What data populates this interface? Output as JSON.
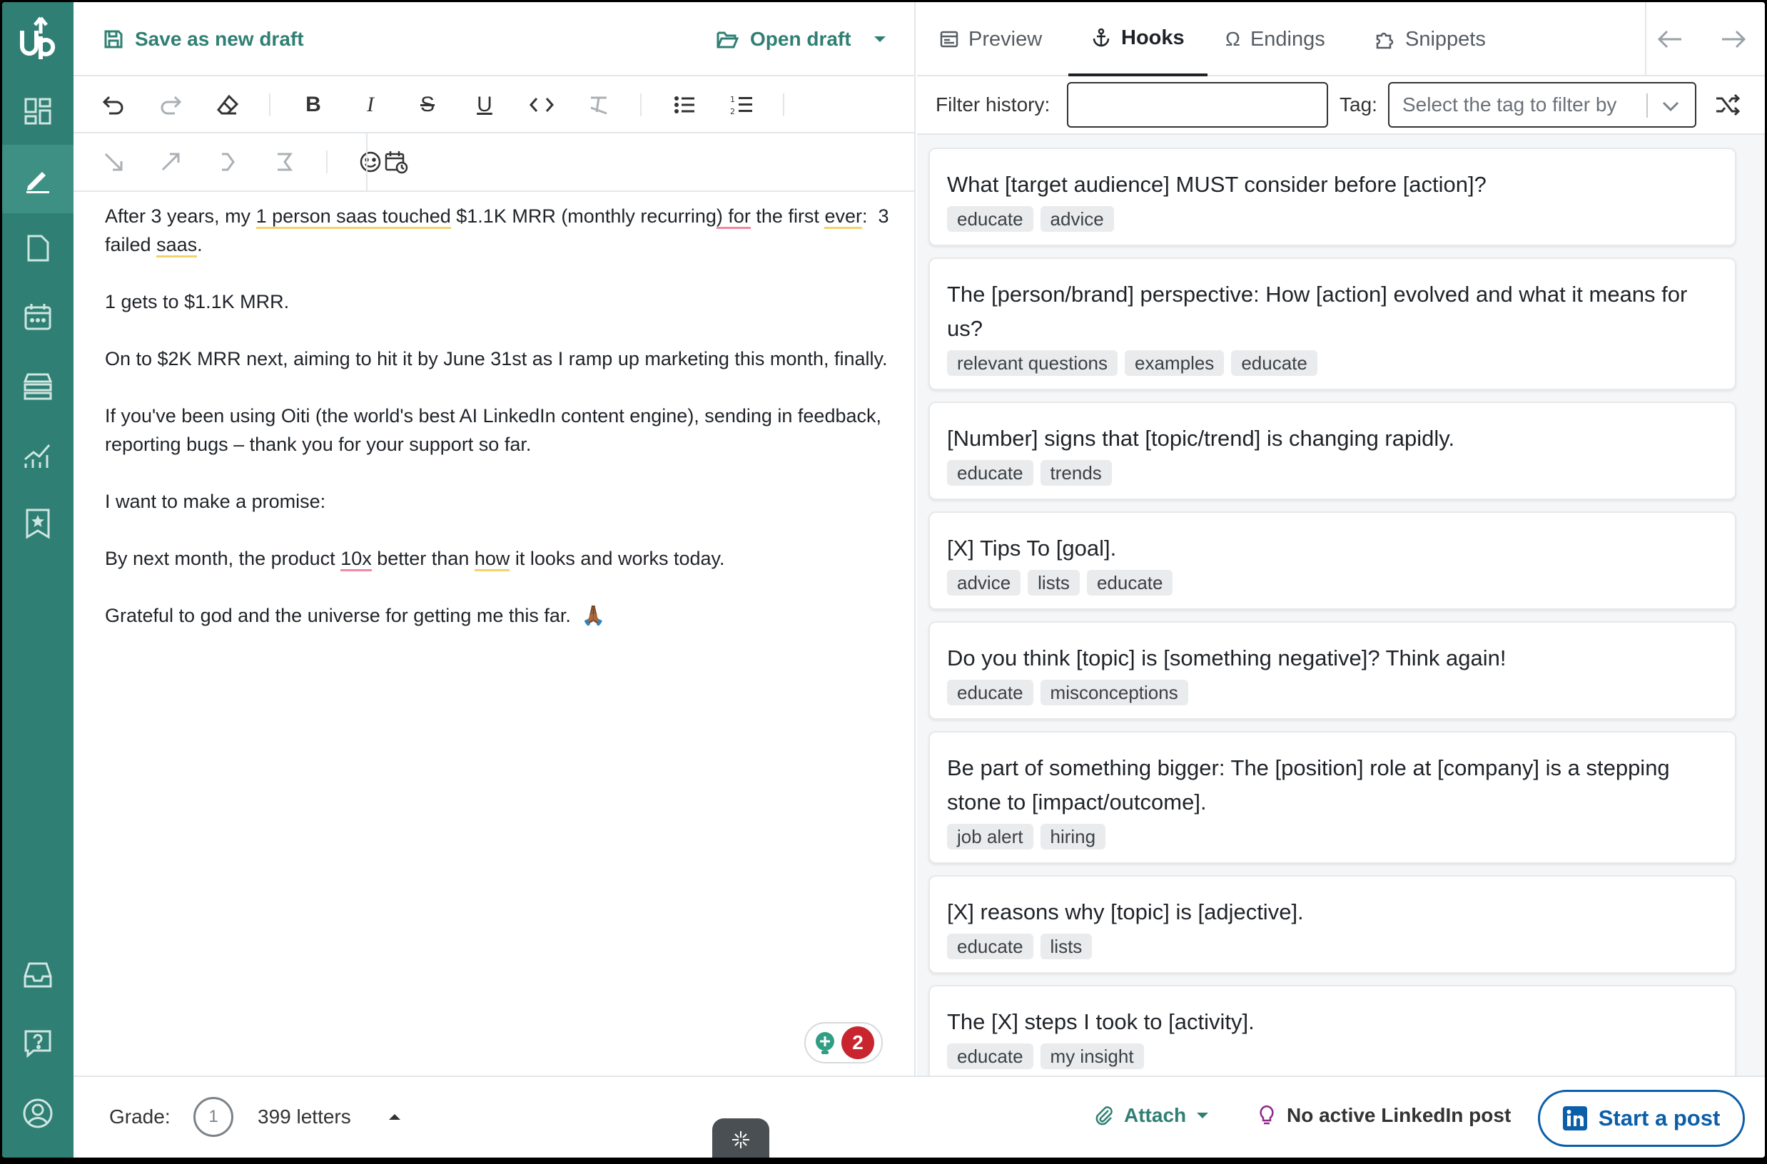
{
  "sidebar": {
    "logo_text": "up",
    "items": [
      {
        "name": "dashboard",
        "icon": "dashboard-icon"
      },
      {
        "name": "write",
        "icon": "pencil-icon",
        "active": true
      },
      {
        "name": "drafts",
        "icon": "document-icon"
      },
      {
        "name": "calendar",
        "icon": "calendar-icon"
      },
      {
        "name": "library",
        "icon": "archive-icon"
      },
      {
        "name": "analytics",
        "icon": "chart-icon"
      },
      {
        "name": "saved",
        "icon": "bookmark-star-icon"
      },
      {
        "name": "inbox",
        "icon": "inbox-icon"
      },
      {
        "name": "help",
        "icon": "help-icon"
      },
      {
        "name": "account",
        "icon": "user-icon"
      }
    ]
  },
  "editor": {
    "save_label": "Save as new draft",
    "open_label": "Open draft",
    "paragraphs": {
      "p1_a": "After 3 years, my ",
      "p1_b": "1 person saas touched",
      "p1_c": " $1.1K MRR (monthly recurring",
      "p1_d": ") for",
      "p1_e": " the first ",
      "p1_f": "ever",
      "p1_g": ":  3 failed ",
      "p1_h": "saas",
      "p1_i": ".",
      "p2": "1 gets to $1.1K MRR.",
      "p3": "On to $2K MRR next, aiming to hit it by June 31st as I ramp up marketing this month, finally.",
      "p4": "If you've been using Oiti (the world's best AI LinkedIn content engine), sending in feedback, reporting bugs – thank you for your support so far.",
      "p5": "I want to make a promise:",
      "p6_a": "By next month, the product ",
      "p6_b": "10x",
      "p6_c": " better than ",
      "p6_d": "how",
      "p6_e": " it looks and works today.",
      "p7": "Grateful to god and the universe for getting me this far.  🙏🏾"
    },
    "grammar_count": "2"
  },
  "panel": {
    "tabs": [
      {
        "label": "Preview"
      },
      {
        "label": "Hooks",
        "active": true
      },
      {
        "label": "Endings"
      },
      {
        "label": "Snippets"
      }
    ],
    "filter_label": "Filter history:",
    "filter_value": "",
    "tag_label": "Tag:",
    "tag_placeholder": "Select the tag to filter by",
    "hooks": [
      {
        "text": "What [target audience] MUST consider before [action]?",
        "tags": [
          "educate",
          "advice"
        ]
      },
      {
        "text": "The [person/brand] perspective: How [action] evolved and what it means for us?",
        "tags": [
          "relevant questions",
          "examples",
          "educate"
        ]
      },
      {
        "text": "[Number] signs that [topic/trend] is changing rapidly.",
        "tags": [
          "educate",
          "trends"
        ]
      },
      {
        "text": "[X] Tips To [goal].",
        "tags": [
          "advice",
          "lists",
          "educate"
        ]
      },
      {
        "text": "Do you think [topic] is [something negative]? Think again!",
        "tags": [
          "educate",
          "misconceptions"
        ]
      },
      {
        "text": "Be part of something bigger: The [position] role at [company] is a stepping stone to [impact/outcome].",
        "tags": [
          "job alert",
          "hiring"
        ]
      },
      {
        "text": "[X] reasons why [topic] is [adjective].",
        "tags": [
          "educate",
          "lists"
        ]
      },
      {
        "text": "The [X] steps I took to [activity].",
        "tags": [
          "educate",
          "my insight"
        ]
      }
    ]
  },
  "bottom": {
    "grade_label": "Grade:",
    "grade_value": "1",
    "letters": "399 letters",
    "attach_label": "Attach",
    "linkedin_status": "No active LinkedIn post",
    "start_post_label": "Start a post"
  },
  "colors": {
    "brand": "#2f7f74",
    "linkedin": "#0b5ea8",
    "error_badge": "#c8252f"
  }
}
